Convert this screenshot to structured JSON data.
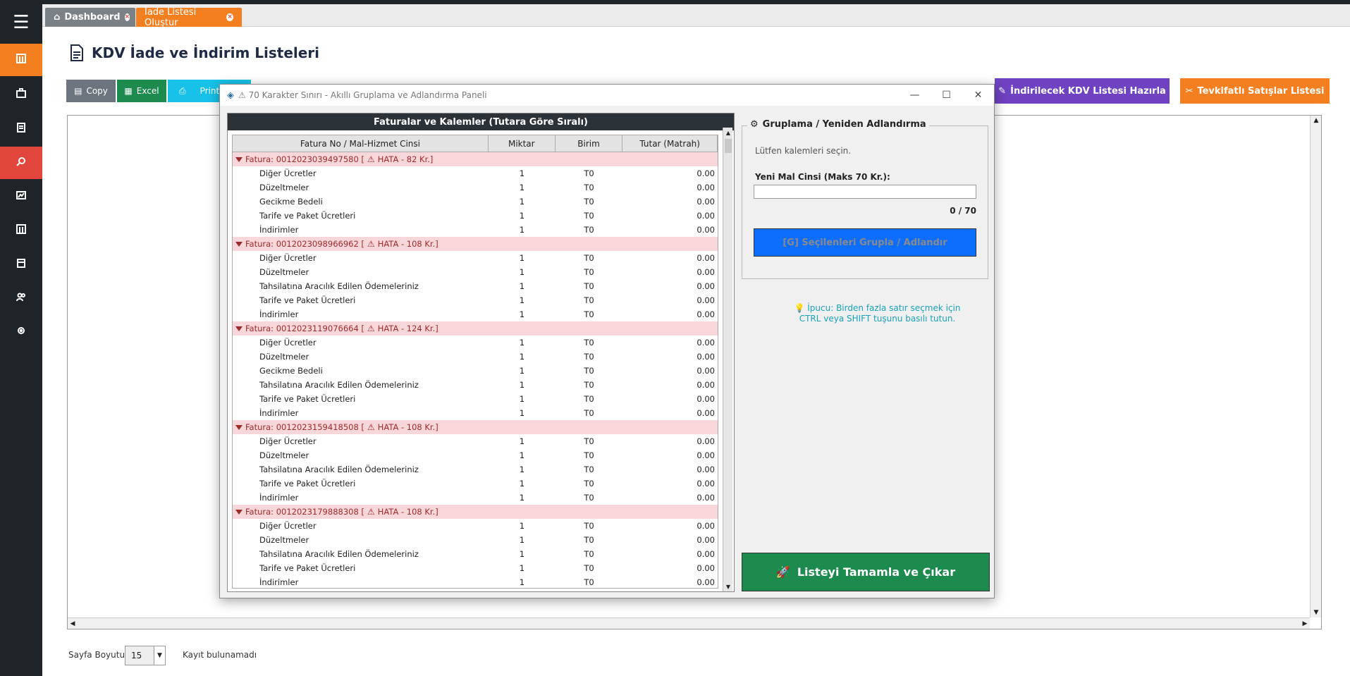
{
  "tabs": [
    {
      "label": "Dashboard"
    },
    {
      "label": "İade Listesi Oluştur"
    }
  ],
  "page_title": "KDV İade ve İndirim Listeleri",
  "buttons": {
    "copy": "Copy",
    "excel": "Excel",
    "print": "Print",
    "kdv": "İndirilecek KDV Listesi Hazırla",
    "tevkifat": "Tevkifatlı Satışlar Listesi"
  },
  "pager": {
    "label": "Sayfa Boyutu:",
    "size": "15",
    "no_records": "Kayıt bulunamadı"
  },
  "modal": {
    "title": "⚠ 70 Karakter Sınırı - Akıllı Gruplama ve Adlandırma Paneli",
    "left_header": "Faturalar ve Kalemler (Tutara Göre Sıralı)",
    "columns": [
      "Fatura No / Mal-Hizmet Cinsi",
      "Miktar",
      "Birim",
      "Tutar (Matrah)"
    ],
    "groups": [
      {
        "label": "Fatura: 0012023039497580 [",
        "error": "HATA - 82 Kr.]",
        "items": [
          {
            "name": "Diğer Ücretler",
            "qty": "1",
            "unit": "T0",
            "amount": "0.00"
          },
          {
            "name": "Düzeltmeler",
            "qty": "1",
            "unit": "T0",
            "amount": "0.00"
          },
          {
            "name": "Gecikme Bedeli",
            "qty": "1",
            "unit": "T0",
            "amount": "0.00"
          },
          {
            "name": "Tarife ve Paket Ücretleri",
            "qty": "1",
            "unit": "T0",
            "amount": "0.00"
          },
          {
            "name": "İndirimler",
            "qty": "1",
            "unit": "T0",
            "amount": "0.00"
          }
        ]
      },
      {
        "label": "Fatura: 0012023098966962 [",
        "error": "HATA - 108 Kr.]",
        "items": [
          {
            "name": "Diğer Ücretler",
            "qty": "1",
            "unit": "T0",
            "amount": "0.00"
          },
          {
            "name": "Düzeltmeler",
            "qty": "1",
            "unit": "T0",
            "amount": "0.00"
          },
          {
            "name": "Tahsilatına Aracılık Edilen Ödemeleriniz",
            "qty": "1",
            "unit": "T0",
            "amount": "0.00"
          },
          {
            "name": "Tarife ve Paket Ücretleri",
            "qty": "1",
            "unit": "T0",
            "amount": "0.00"
          },
          {
            "name": "İndirimler",
            "qty": "1",
            "unit": "T0",
            "amount": "0.00"
          }
        ]
      },
      {
        "label": "Fatura: 0012023119076664 [",
        "error": "HATA - 124 Kr.]",
        "items": [
          {
            "name": "Diğer Ücretler",
            "qty": "1",
            "unit": "T0",
            "amount": "0.00"
          },
          {
            "name": "Düzeltmeler",
            "qty": "1",
            "unit": "T0",
            "amount": "0.00"
          },
          {
            "name": "Gecikme Bedeli",
            "qty": "1",
            "unit": "T0",
            "amount": "0.00"
          },
          {
            "name": "Tahsilatına Aracılık Edilen Ödemeleriniz",
            "qty": "1",
            "unit": "T0",
            "amount": "0.00"
          },
          {
            "name": "Tarife ve Paket Ücretleri",
            "qty": "1",
            "unit": "T0",
            "amount": "0.00"
          },
          {
            "name": "İndirimler",
            "qty": "1",
            "unit": "T0",
            "amount": "0.00"
          }
        ]
      },
      {
        "label": "Fatura: 0012023159418508 [",
        "error": "HATA - 108 Kr.]",
        "items": [
          {
            "name": "Diğer Ücretler",
            "qty": "1",
            "unit": "T0",
            "amount": "0.00"
          },
          {
            "name": "Düzeltmeler",
            "qty": "1",
            "unit": "T0",
            "amount": "0.00"
          },
          {
            "name": "Tahsilatına Aracılık Edilen Ödemeleriniz",
            "qty": "1",
            "unit": "T0",
            "amount": "0.00"
          },
          {
            "name": "Tarife ve Paket Ücretleri",
            "qty": "1",
            "unit": "T0",
            "amount": "0.00"
          },
          {
            "name": "İndirimler",
            "qty": "1",
            "unit": "T0",
            "amount": "0.00"
          }
        ]
      },
      {
        "label": "Fatura: 0012023179888308 [",
        "error": "HATA - 108 Kr.]",
        "items": [
          {
            "name": "Diğer Ücretler",
            "qty": "1",
            "unit": "T0",
            "amount": "0.00"
          },
          {
            "name": "Düzeltmeler",
            "qty": "1",
            "unit": "T0",
            "amount": "0.00"
          },
          {
            "name": "Tahsilatına Aracılık Edilen Ödemeleriniz",
            "qty": "1",
            "unit": "T0",
            "amount": "0.00"
          },
          {
            "name": "Tarife ve Paket Ücretleri",
            "qty": "1",
            "unit": "T0",
            "amount": "0.00"
          },
          {
            "name": "İndirimler",
            "qty": "1",
            "unit": "T0",
            "amount": "0.00"
          }
        ]
      }
    ],
    "right": {
      "legend": "Gruplama / Yeniden Adlandırma",
      "hint": "Lütfen kalemleri seçin.",
      "label": "Yeni Mal Cinsi (Maks 70 Kr.):",
      "input_value": "",
      "counter": "0 / 70",
      "group_button": "[G] Seçilenleri Grupla / Adlandır",
      "tip_line1": "💡 İpucu: Birden fazla satır seçmek için",
      "tip_line2": "CTRL veya SHIFT tuşunu basılı tutun.",
      "finish_button": "Listeyi Tamamla ve Çıkar"
    }
  },
  "colors": {
    "sidebar_bg": "#1f2428",
    "accent_orange": "#f47f20",
    "accent_red": "#e2453c",
    "purple": "#6f42c1",
    "green": "#1d8a4e",
    "blue": "#0d6efd"
  }
}
